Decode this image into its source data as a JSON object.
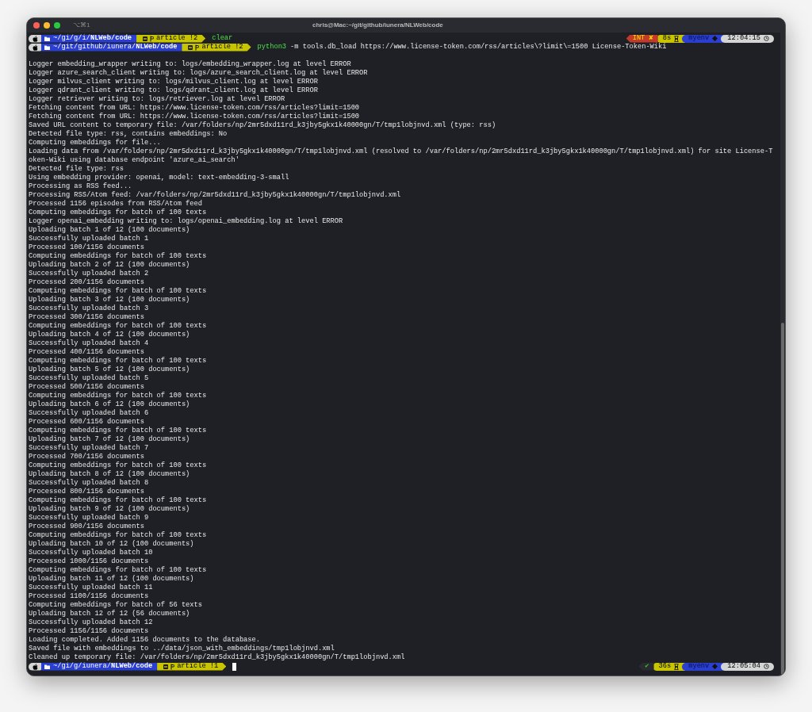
{
  "window": {
    "title": "chris@Mac:~/git/github/iunera/NLWeb/code",
    "shortcut": "⌥⌘1"
  },
  "terminal": {
    "lines": [
      {
        "kind": "prompt",
        "cursor": false,
        "segments": [
          {
            "kind": "os"
          },
          {
            "kind": "dir",
            "text": "~/gi/g/i/**NLWeb/code**"
          },
          {
            "kind": "git",
            "text": "article !2"
          }
        ],
        "program": "clear",
        "right": [
          {
            "kind": "error",
            "text": "INT ✘"
          },
          {
            "kind": "duration",
            "text": "8s"
          },
          {
            "kind": "env",
            "text": "myenv"
          },
          {
            "kind": "time",
            "text": "12:04:15"
          }
        ]
      },
      {
        "kind": "prompt",
        "cursor": false,
        "segments": [
          {
            "kind": "os"
          },
          {
            "kind": "dir",
            "text": "~/git/github/iunera/**NLWeb/code**"
          },
          {
            "kind": "git",
            "text": "article !2"
          }
        ],
        "program": "python3",
        "args": "-m tools.db_load https://www.license-token.com/rss/articles\\?limit\\=1500 License-Token-Wiki"
      },
      {
        "kind": "blank"
      },
      {
        "kind": "output",
        "text": "Logger embedding_wrapper writing to: logs/embedding_wrapper.log at level ERROR"
      },
      {
        "kind": "output",
        "text": "Logger azure_search_client writing to: logs/azure_search_client.log at level ERROR"
      },
      {
        "kind": "output",
        "text": "Logger milvus_client writing to: logs/milvus_client.log at level ERROR"
      },
      {
        "kind": "output",
        "text": "Logger qdrant_client writing to: logs/qdrant_client.log at level ERROR"
      },
      {
        "kind": "output",
        "text": "Logger retriever writing to: logs/retriever.log at level ERROR"
      },
      {
        "kind": "output",
        "text": "Fetching content from URL: https://www.license-token.com/rss/articles?limit=1500"
      },
      {
        "kind": "output",
        "text": "Fetching content from URL: https://www.license-token.com/rss/articles?limit=1500"
      },
      {
        "kind": "output",
        "text": "Saved URL content to temporary file: /var/folders/np/2mr5dxd11rd_k3jby5gkx1k40000gn/T/tmp1lobjnvd.xml (type: rss)"
      },
      {
        "kind": "output",
        "text": "Detected file type: rss, contains embeddings: No"
      },
      {
        "kind": "output",
        "text": "Computing embeddings for file..."
      },
      {
        "kind": "output",
        "text": "Loading data from /var/folders/np/2mr5dxd11rd_k3jby5gkx1k40000gn/T/tmp1lobjnvd.xml (resolved to /var/folders/np/2mr5dxd11rd_k3jby5gkx1k40000gn/T/tmp1lobjnvd.xml) for site License-T"
      },
      {
        "kind": "output",
        "text": "oken-Wiki using database endpoint 'azure_ai_search'"
      },
      {
        "kind": "output",
        "text": "Detected file type: rss"
      },
      {
        "kind": "output",
        "text": "Using embedding provider: openai, model: text-embedding-3-small"
      },
      {
        "kind": "output",
        "text": "Processing as RSS feed..."
      },
      {
        "kind": "output",
        "text": "Processing RSS/Atom feed: /var/folders/np/2mr5dxd11rd_k3jby5gkx1k40000gn/T/tmp1lobjnvd.xml"
      },
      {
        "kind": "output",
        "text": "Processed 1156 episodes from RSS/Atom feed"
      },
      {
        "kind": "output",
        "text": "Computing embeddings for batch of 100 texts"
      },
      {
        "kind": "output",
        "text": "Logger openai_embedding writing to: logs/openai_embedding.log at level ERROR"
      },
      {
        "kind": "output",
        "text": "Uploading batch 1 of 12 (100 documents)"
      },
      {
        "kind": "output",
        "text": "Successfully uploaded batch 1"
      },
      {
        "kind": "output",
        "text": "Processed 100/1156 documents"
      },
      {
        "kind": "output",
        "text": "Computing embeddings for batch of 100 texts"
      },
      {
        "kind": "output",
        "text": "Uploading batch 2 of 12 (100 documents)"
      },
      {
        "kind": "output",
        "text": "Successfully uploaded batch 2"
      },
      {
        "kind": "output",
        "text": "Processed 200/1156 documents"
      },
      {
        "kind": "output",
        "text": "Computing embeddings for batch of 100 texts"
      },
      {
        "kind": "output",
        "text": "Uploading batch 3 of 12 (100 documents)"
      },
      {
        "kind": "output",
        "text": "Successfully uploaded batch 3"
      },
      {
        "kind": "output",
        "text": "Processed 300/1156 documents"
      },
      {
        "kind": "output",
        "text": "Computing embeddings for batch of 100 texts"
      },
      {
        "kind": "output",
        "text": "Uploading batch 4 of 12 (100 documents)"
      },
      {
        "kind": "output",
        "text": "Successfully uploaded batch 4"
      },
      {
        "kind": "output",
        "text": "Processed 400/1156 documents"
      },
      {
        "kind": "output",
        "text": "Computing embeddings for batch of 100 texts"
      },
      {
        "kind": "output",
        "text": "Uploading batch 5 of 12 (100 documents)"
      },
      {
        "kind": "output",
        "text": "Successfully uploaded batch 5"
      },
      {
        "kind": "output",
        "text": "Processed 500/1156 documents"
      },
      {
        "kind": "output",
        "text": "Computing embeddings for batch of 100 texts"
      },
      {
        "kind": "output",
        "text": "Uploading batch 6 of 12 (100 documents)"
      },
      {
        "kind": "output",
        "text": "Successfully uploaded batch 6"
      },
      {
        "kind": "output",
        "text": "Processed 600/1156 documents"
      },
      {
        "kind": "output",
        "text": "Computing embeddings for batch of 100 texts"
      },
      {
        "kind": "output",
        "text": "Uploading batch 7 of 12 (100 documents)"
      },
      {
        "kind": "output",
        "text": "Successfully uploaded batch 7"
      },
      {
        "kind": "output",
        "text": "Processed 700/1156 documents"
      },
      {
        "kind": "output",
        "text": "Computing embeddings for batch of 100 texts"
      },
      {
        "kind": "output",
        "text": "Uploading batch 8 of 12 (100 documents)"
      },
      {
        "kind": "output",
        "text": "Successfully uploaded batch 8"
      },
      {
        "kind": "output",
        "text": "Processed 800/1156 documents"
      },
      {
        "kind": "output",
        "text": "Computing embeddings for batch of 100 texts"
      },
      {
        "kind": "output",
        "text": "Uploading batch 9 of 12 (100 documents)"
      },
      {
        "kind": "output",
        "text": "Successfully uploaded batch 9"
      },
      {
        "kind": "output",
        "text": "Processed 900/1156 documents"
      },
      {
        "kind": "output",
        "text": "Computing embeddings for batch of 100 texts"
      },
      {
        "kind": "output",
        "text": "Uploading batch 10 of 12 (100 documents)"
      },
      {
        "kind": "output",
        "text": "Successfully uploaded batch 10"
      },
      {
        "kind": "output",
        "text": "Processed 1000/1156 documents"
      },
      {
        "kind": "output",
        "text": "Computing embeddings for batch of 100 texts"
      },
      {
        "kind": "output",
        "text": "Uploading batch 11 of 12 (100 documents)"
      },
      {
        "kind": "output",
        "text": "Successfully uploaded batch 11"
      },
      {
        "kind": "output",
        "text": "Processed 1100/1156 documents"
      },
      {
        "kind": "output",
        "text": "Computing embeddings for batch of 56 texts"
      },
      {
        "kind": "output",
        "text": "Uploading batch 12 of 12 (56 documents)"
      },
      {
        "kind": "output",
        "text": "Successfully uploaded batch 12"
      },
      {
        "kind": "output",
        "text": "Processed 1156/1156 documents"
      },
      {
        "kind": "output",
        "text": "Loading completed. Added 1156 documents to the database."
      },
      {
        "kind": "output",
        "text": "Saved file with embeddings to ../data/json_with_embeddings/tmp1lobjnvd.xml"
      },
      {
        "kind": "output",
        "text": "Cleaned up temporary file: /var/folders/np/2mr5dxd11rd_k3jby5gkx1k40000gn/T/tmp1lobjnvd.xml"
      },
      {
        "kind": "prompt",
        "cursor": true,
        "segments": [
          {
            "kind": "os"
          },
          {
            "kind": "dir",
            "text": "~/gi/g/iunera/**NLWeb/code**"
          },
          {
            "kind": "git",
            "text": "article !1"
          }
        ],
        "right": [
          {
            "kind": "ok",
            "text": "✔"
          },
          {
            "kind": "duration",
            "text": "36s"
          },
          {
            "kind": "env",
            "text": "myenv"
          },
          {
            "kind": "time",
            "text": "12:05:04"
          }
        ]
      }
    ]
  }
}
